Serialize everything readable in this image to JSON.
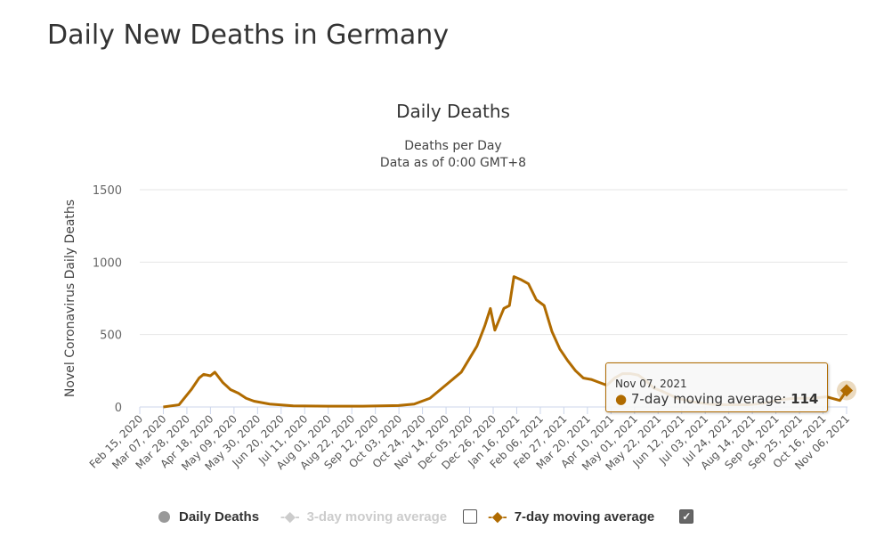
{
  "page_title": "Daily New Deaths in Germany",
  "chart_data": {
    "type": "line",
    "title": "Daily Deaths",
    "subtitle_1": "Deaths per Day",
    "subtitle_2": "Data as of 0:00 GMT+8",
    "ylabel": "Novel Coronavirus Daily Deaths",
    "ylim": [
      0,
      1500
    ],
    "yticks": [
      "0",
      "500",
      "1000",
      "1500"
    ],
    "xlim": [
      "2020-02-15",
      "2021-11-07"
    ],
    "xtick_labels": [
      "Feb 15, 2020",
      "Mar 07, 2020",
      "Mar 28, 2020",
      "Apr 18, 2020",
      "May 09, 2020",
      "May 30, 2020",
      "Jun 20, 2020",
      "Jul 11, 2020",
      "Aug 01, 2020",
      "Aug 22, 2020",
      "Sep 12, 2020",
      "Oct 03, 2020",
      "Oct 24, 2020",
      "Nov 14, 2020",
      "Dec 05, 2020",
      "Dec 26, 2020",
      "Jan 16, 2021",
      "Feb 06, 2021",
      "Feb 27, 2021",
      "Mar 20, 2021",
      "Apr 10, 2021",
      "May 01, 2021",
      "May 22, 2021",
      "Jun 12, 2021",
      "Jul 03, 2021",
      "Jul 24, 2021",
      "Aug 14, 2021",
      "Sep 04, 2021",
      "Sep 25, 2021",
      "Oct 16, 2021",
      "Nov 06, 2021"
    ],
    "grid": true,
    "legend_placement": "bottom",
    "legend": [
      {
        "name": "Daily Deaths",
        "color": "#999999",
        "visible": true
      },
      {
        "name": "3-day moving average",
        "color": "#cccccc",
        "visible": false
      },
      {
        "name": "7-day moving average",
        "color": "#b06b00",
        "visible": true
      }
    ],
    "series": [
      {
        "name": "7-day moving average",
        "color": "#b06b00",
        "points": [
          [
            "2020-03-07",
            0
          ],
          [
            "2020-03-21",
            15
          ],
          [
            "2020-04-01",
            120
          ],
          [
            "2020-04-08",
            200
          ],
          [
            "2020-04-12",
            225
          ],
          [
            "2020-04-18",
            215
          ],
          [
            "2020-04-22",
            240
          ],
          [
            "2020-04-29",
            170
          ],
          [
            "2020-05-06",
            120
          ],
          [
            "2020-05-13",
            95
          ],
          [
            "2020-05-20",
            60
          ],
          [
            "2020-05-27",
            40
          ],
          [
            "2020-06-10",
            20
          ],
          [
            "2020-07-01",
            8
          ],
          [
            "2020-08-01",
            5
          ],
          [
            "2020-09-01",
            5
          ],
          [
            "2020-10-03",
            10
          ],
          [
            "2020-10-17",
            20
          ],
          [
            "2020-10-31",
            60
          ],
          [
            "2020-11-14",
            150
          ],
          [
            "2020-11-28",
            240
          ],
          [
            "2020-12-05",
            330
          ],
          [
            "2020-12-12",
            420
          ],
          [
            "2020-12-19",
            560
          ],
          [
            "2020-12-24",
            680
          ],
          [
            "2020-12-28",
            530
          ],
          [
            "2021-01-05",
            680
          ],
          [
            "2021-01-10",
            700
          ],
          [
            "2021-01-14",
            900
          ],
          [
            "2021-01-20",
            880
          ],
          [
            "2021-01-27",
            850
          ],
          [
            "2021-02-03",
            740
          ],
          [
            "2021-02-10",
            700
          ],
          [
            "2021-02-17",
            520
          ],
          [
            "2021-02-24",
            400
          ],
          [
            "2021-03-03",
            320
          ],
          [
            "2021-03-10",
            250
          ],
          [
            "2021-03-17",
            200
          ],
          [
            "2021-03-24",
            190
          ],
          [
            "2021-03-31",
            170
          ],
          [
            "2021-04-07",
            150
          ],
          [
            "2021-04-14",
            200
          ],
          [
            "2021-04-21",
            230
          ],
          [
            "2021-04-28",
            230
          ],
          [
            "2021-05-05",
            220
          ],
          [
            "2021-05-12",
            180
          ],
          [
            "2021-05-19",
            130
          ],
          [
            "2021-05-26",
            110
          ],
          [
            "2021-06-09",
            60
          ],
          [
            "2021-06-23",
            35
          ],
          [
            "2021-07-07",
            20
          ],
          [
            "2021-07-21",
            15
          ],
          [
            "2021-08-11",
            15
          ],
          [
            "2021-08-25",
            25
          ],
          [
            "2021-09-08",
            50
          ],
          [
            "2021-09-22",
            60
          ],
          [
            "2021-10-06",
            60
          ],
          [
            "2021-10-20",
            70
          ],
          [
            "2021-11-01",
            45
          ],
          [
            "2021-11-07",
            114
          ]
        ]
      }
    ],
    "tooltip": {
      "date": "Nov 07, 2021",
      "series": "7-day moving average",
      "label": "7-day moving average: ",
      "value": "114"
    }
  }
}
